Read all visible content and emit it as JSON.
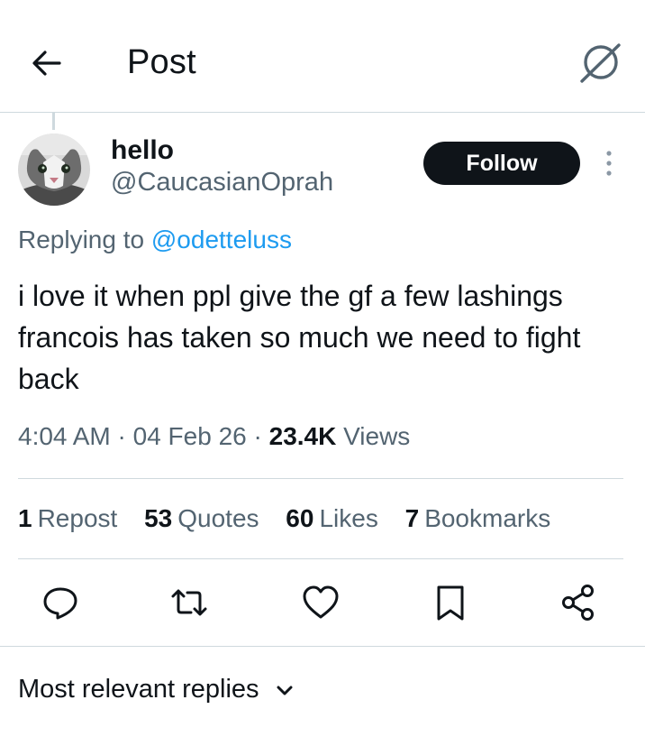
{
  "header": {
    "title": "Post",
    "back_icon": "arrow-left-icon",
    "grok_icon": "grok-icon"
  },
  "author": {
    "display_name": "hello",
    "handle": "@CaucasianOprah",
    "follow_label": "Follow",
    "avatar": "cat-avatar"
  },
  "reply": {
    "prefix": "Replying to",
    "mention": "@odetteluss"
  },
  "tweet": {
    "text": "i love it when ppl give the gf a few lashings francois has taken so much we need to fight back"
  },
  "meta": {
    "time": "4:04 AM",
    "separator": "·",
    "date": "04 Feb 26",
    "views_count": "23.4K",
    "views_label": "Views"
  },
  "stats": [
    {
      "count": "1",
      "label": "Repost"
    },
    {
      "count": "53",
      "label": "Quotes"
    },
    {
      "count": "60",
      "label": "Likes"
    },
    {
      "count": "7",
      "label": "Bookmarks"
    }
  ],
  "actions": [
    "reply-icon",
    "repost-icon",
    "like-icon",
    "bookmark-icon",
    "share-icon"
  ],
  "sort": {
    "label": "Most relevant replies",
    "icon": "chevron-down-icon"
  },
  "colors": {
    "text": "#0f1419",
    "secondary": "#536471",
    "link": "#1d9bf0",
    "divider": "#cfd9de"
  }
}
